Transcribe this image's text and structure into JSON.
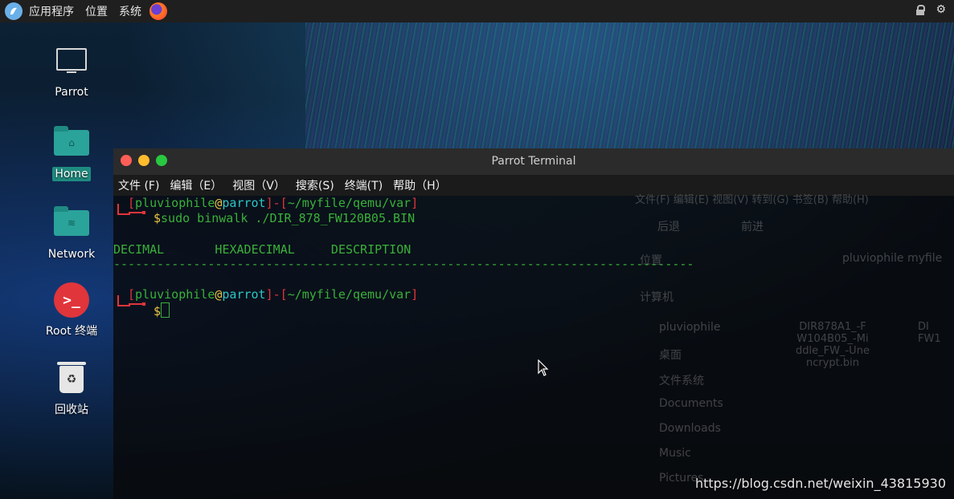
{
  "top_panel": {
    "menu_applications": "应用程序",
    "menu_places": "位置",
    "menu_system": "系统",
    "icons": [
      "parrot-menu-icon",
      "firefox-icon",
      "lock-icon",
      "power-icon"
    ]
  },
  "desktop": {
    "icons": [
      {
        "label": "Parrot",
        "icon": "computer-icon"
      },
      {
        "label": "Home",
        "icon": "home-folder-icon",
        "selected": true
      },
      {
        "label": "Network",
        "icon": "network-folder-icon"
      },
      {
        "label": "Root 终端",
        "icon": "root-terminal-icon"
      },
      {
        "label": "回收站",
        "icon": "trash-icon"
      }
    ]
  },
  "terminal": {
    "title": "Parrot Terminal",
    "menu": [
      "文件 (F)",
      "编辑（E）",
      "视图（V）",
      "搜索(S)",
      "终端(T)",
      "帮助（H）"
    ],
    "prompt1": {
      "bracket_open": "[",
      "user": "pluviophile",
      "at": "@",
      "host": "parrot",
      "sep": "]-[",
      "path": "~/myfile/qemu/var",
      "bracket_close": "]",
      "dollar": "$",
      "command": "sudo binwalk ./DIR_878_FW120B05.BIN"
    },
    "table_header": "DECIMAL       HEXADECIMAL     DESCRIPTION",
    "dash_line": "--------------------------------------------------------------------------------",
    "prompt2": {
      "bracket_open": "[",
      "user": "pluviophile",
      "at": "@",
      "host": "parrot",
      "sep": "]-[",
      "path": "~/myfile/qemu/var",
      "bracket_close": "]",
      "dollar": "$"
    }
  },
  "file_manager_behind": {
    "menubar": "文件(F)  编辑(E)  视图(V)  转到(G)  书签(B)  帮助(H)",
    "back": "后退",
    "forward": "前进",
    "places": "位置",
    "path_crumb": "pluviophile   myfile",
    "computer": "计算机",
    "sidebar": [
      "pluviophile",
      "桌面",
      "文件系统",
      "Documents",
      "Downloads",
      "Music",
      "Pictures"
    ],
    "file_name": "DIR878A1_-FW104B05_-Middle_FW_-Unencrypt.bin",
    "file_name_partial": "DI FW1"
  },
  "watermark": "https://blog.csdn.net/weixin_43815930",
  "colors": {
    "prompt_red": "#e0353b",
    "prompt_green": "#3ab03a",
    "host_cyan": "#2dc6c6",
    "at_yellow": "#e8c545",
    "selection_teal": "#1e8b7f"
  }
}
